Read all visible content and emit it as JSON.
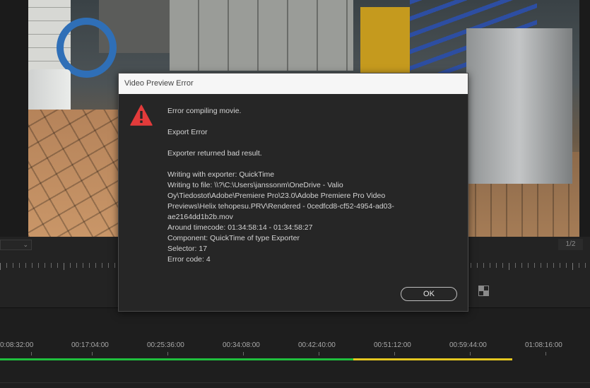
{
  "viewer": {
    "fit_value": "",
    "page_counter": "1/2"
  },
  "timeline": {
    "timecodes": [
      "0:08:32:00",
      "00:17:04:00",
      "00:25:36:00",
      "00:34:08:00",
      "00:42:40:00",
      "00:51:12:00",
      "00:59:44:00",
      "01:08:16:00"
    ],
    "render_status_colors": {
      "rendered": "#1fbf3d",
      "unrendered": "#e4c620"
    }
  },
  "dialog": {
    "title": "Video Preview Error",
    "icon": "warning-triangle-icon",
    "icon_color": "#e23b3b",
    "heading": "Error compiling movie.",
    "error_type": "Export Error",
    "error_summary": "Exporter returned bad result.",
    "details": [
      "Writing with exporter: QuickTime",
      "Writing to file: \\\\?\\C:\\Users\\janssonm\\OneDrive - Valio",
      "Oy\\Tiedostot\\Adobe\\Premiere Pro\\23.0\\Adobe Premiere Pro Video",
      "Previews\\Helix tehopesu.PRV\\Rendered - 0cedfcd8-cf52-4954-ad03-",
      "ae2164dd1b2b.mov",
      "Around timecode: 01:34:58:14 - 01:34:58:27",
      "Component: QuickTime of type Exporter",
      "Selector: 17",
      "Error code: 4"
    ],
    "ok_label": "OK"
  }
}
